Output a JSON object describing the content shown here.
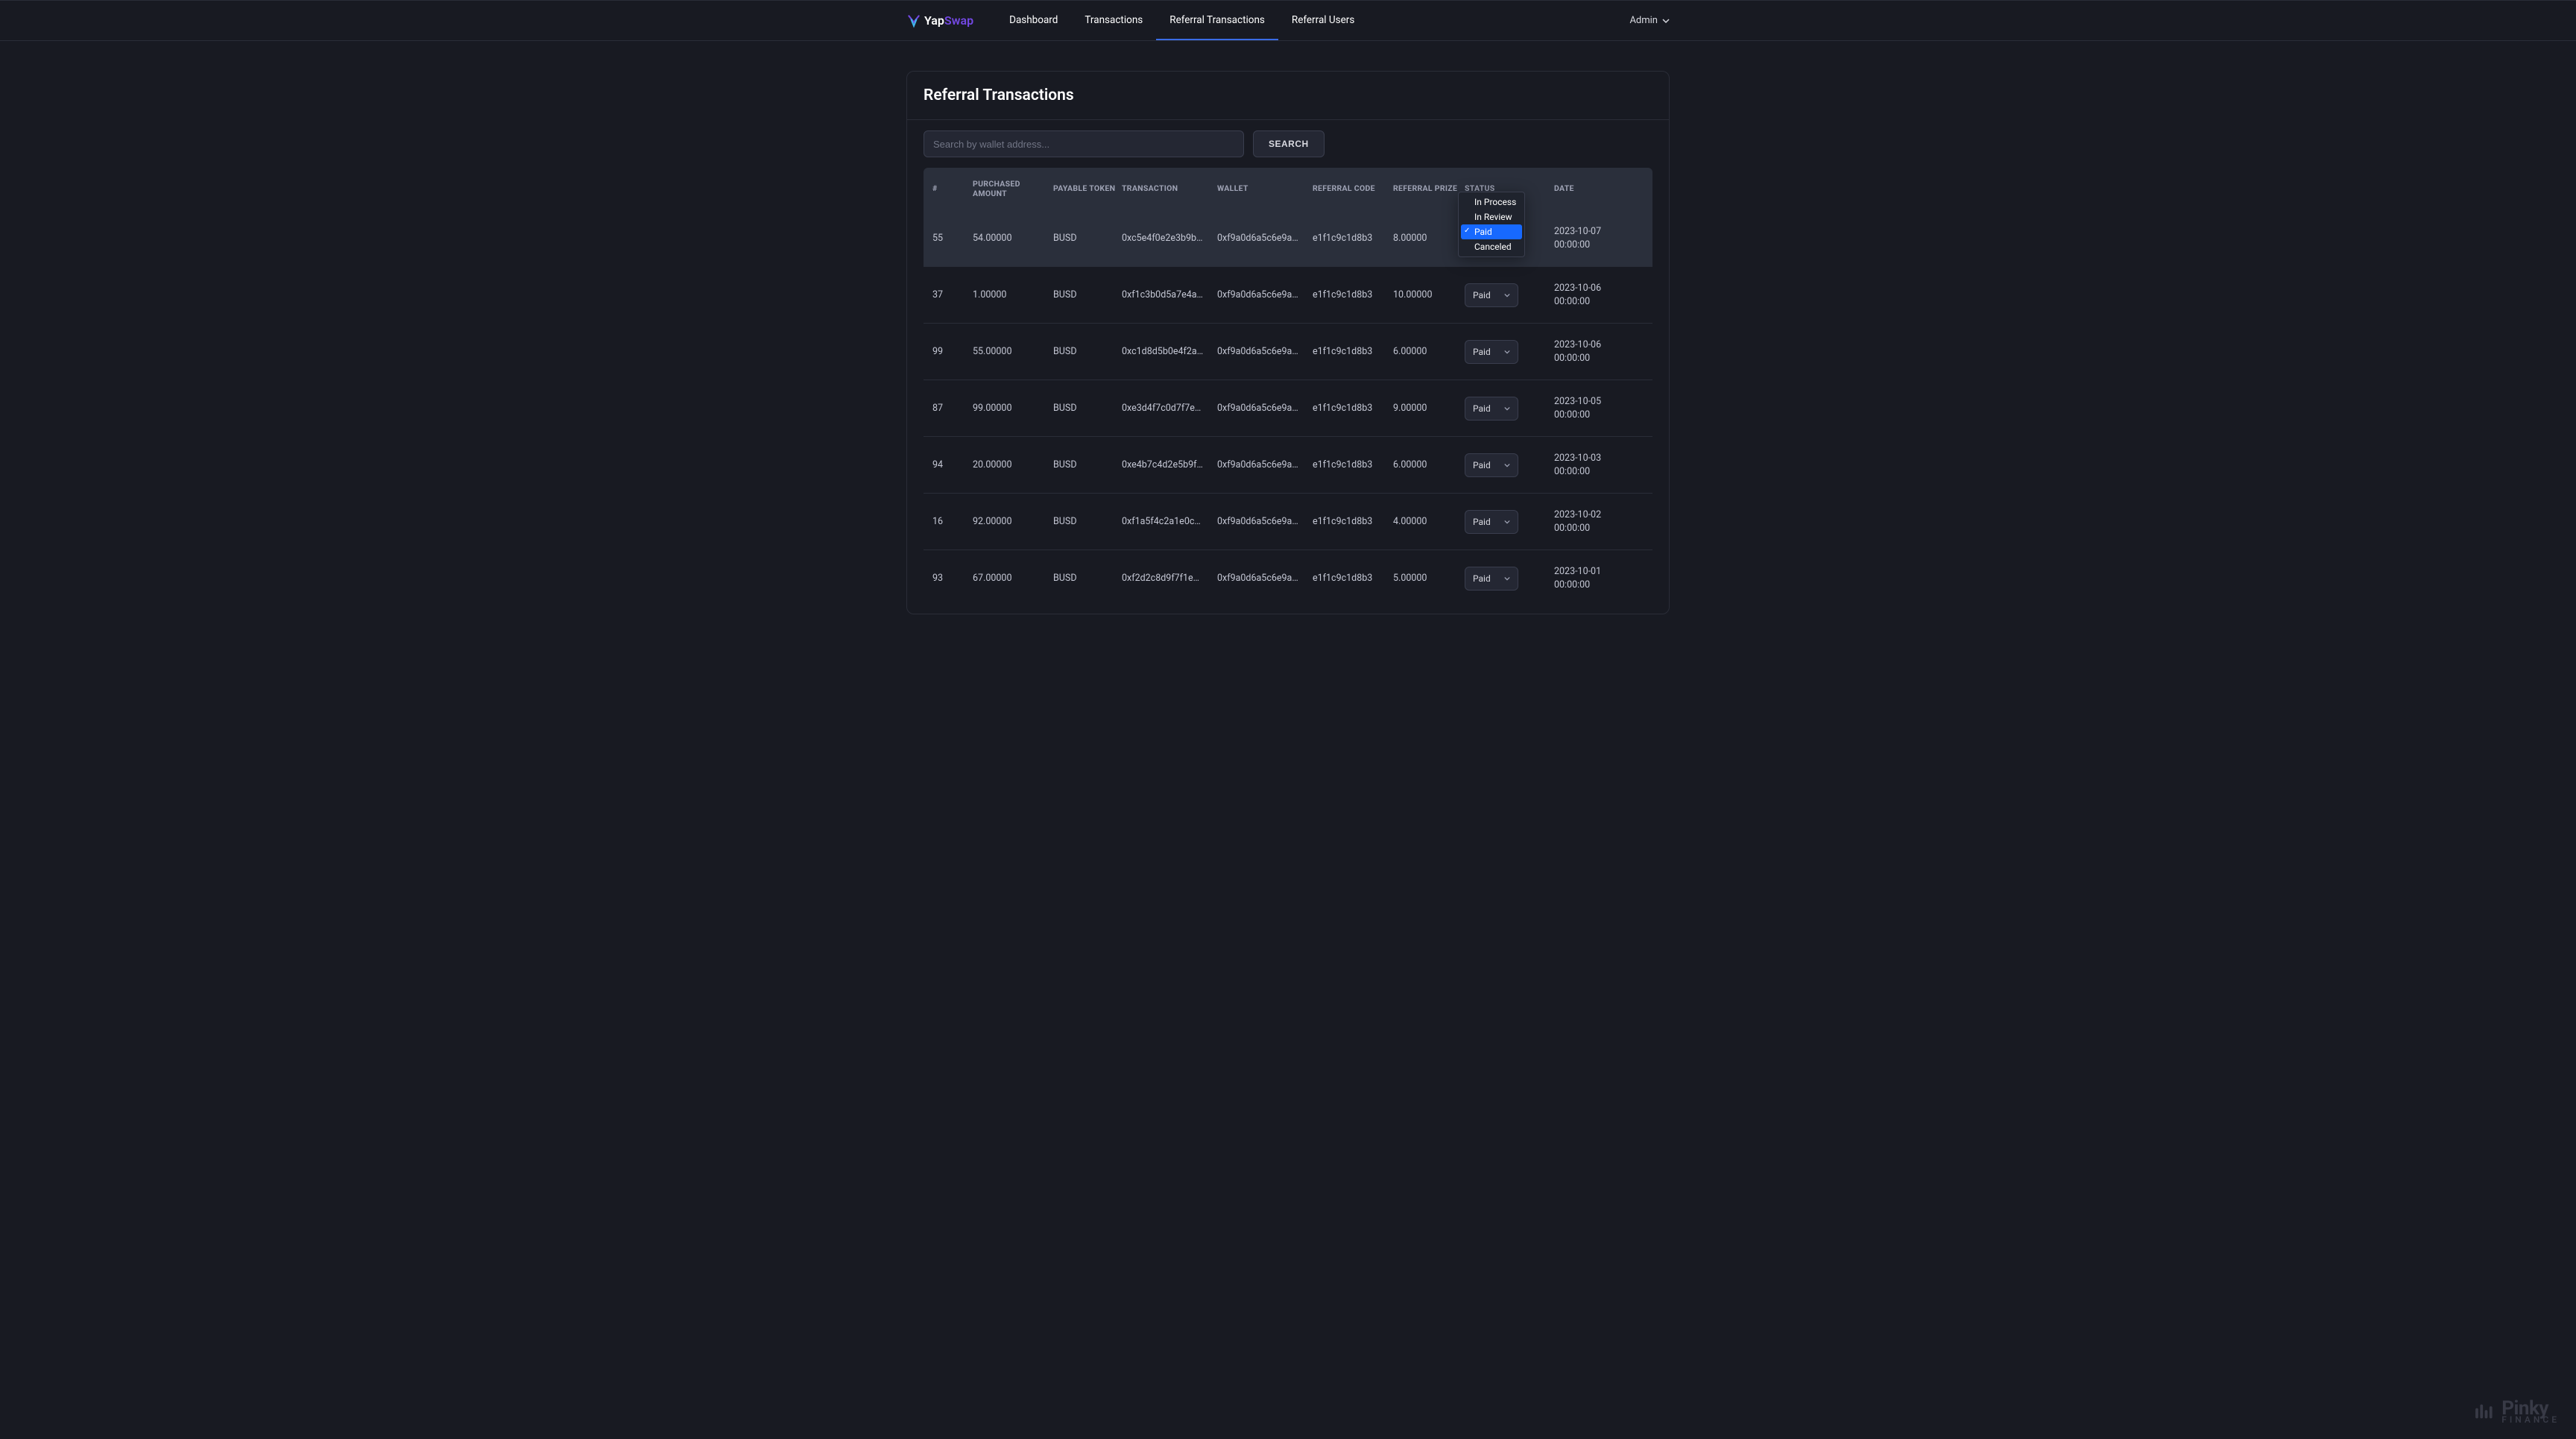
{
  "nav": {
    "brand_a": "Yap",
    "brand_b": "Swap",
    "links": [
      {
        "label": "Dashboard",
        "active": false
      },
      {
        "label": "Transactions",
        "active": false
      },
      {
        "label": "Referral Transactions",
        "active": true
      },
      {
        "label": "Referral Users",
        "active": false
      }
    ],
    "user_label": "Admin"
  },
  "page": {
    "title": "Referral Transactions",
    "search_placeholder": "Search by wallet address...",
    "search_button": "SEARCH"
  },
  "table": {
    "headers": [
      "#",
      "PURCHASED AMOUNT",
      "PAYABLE TOKEN",
      "TRANSACTION",
      "WALLET",
      "REFERRAL CODE",
      "REFERRAL PRIZE",
      "STATUS",
      "DATE"
    ],
    "rows": [
      {
        "id": "55",
        "purchased": "54.00000",
        "token": "BUSD",
        "tx": "0xc5e4f0e2e3b9b…",
        "wallet": "0xf9a0d6a5c6e9a…",
        "code": "e1f1c9c1d8b3",
        "prize": "8.00000",
        "status": "Paid",
        "date": "2023-10-07 00:00:00",
        "dropdown_open": true
      },
      {
        "id": "37",
        "purchased": "1.00000",
        "token": "BUSD",
        "tx": "0xf1c3b0d5a7e4a…",
        "wallet": "0xf9a0d6a5c6e9a…",
        "code": "e1f1c9c1d8b3",
        "prize": "10.00000",
        "status": "Paid",
        "date": "2023-10-06 00:00:00"
      },
      {
        "id": "99",
        "purchased": "55.00000",
        "token": "BUSD",
        "tx": "0xc1d8d5b0e4f2a…",
        "wallet": "0xf9a0d6a5c6e9a…",
        "code": "e1f1c9c1d8b3",
        "prize": "6.00000",
        "status": "Paid",
        "date": "2023-10-06 00:00:00"
      },
      {
        "id": "87",
        "purchased": "99.00000",
        "token": "BUSD",
        "tx": "0xe3d4f7c0d7f7e…",
        "wallet": "0xf9a0d6a5c6e9a…",
        "code": "e1f1c9c1d8b3",
        "prize": "9.00000",
        "status": "Paid",
        "date": "2023-10-05 00:00:00"
      },
      {
        "id": "94",
        "purchased": "20.00000",
        "token": "BUSD",
        "tx": "0xe4b7c4d2e5b9f…",
        "wallet": "0xf9a0d6a5c6e9a…",
        "code": "e1f1c9c1d8b3",
        "prize": "6.00000",
        "status": "Paid",
        "date": "2023-10-03 00:00:00"
      },
      {
        "id": "16",
        "purchased": "92.00000",
        "token": "BUSD",
        "tx": "0xf1a5f4c2a1e0c…",
        "wallet": "0xf9a0d6a5c6e9a…",
        "code": "e1f1c9c1d8b3",
        "prize": "4.00000",
        "status": "Paid",
        "date": "2023-10-02 00:00:00"
      },
      {
        "id": "93",
        "purchased": "67.00000",
        "token": "BUSD",
        "tx": "0xf2d2c8d9f7f1e…",
        "wallet": "0xf9a0d6a5c6e9a…",
        "code": "e1f1c9c1d8b3",
        "prize": "5.00000",
        "status": "Paid",
        "date": "2023-10-01 00:00:00"
      }
    ]
  },
  "status_options": [
    "In Process",
    "In Review",
    "Paid",
    "Canceled"
  ],
  "watermark": {
    "brand": "Pinky",
    "sub": "FINANCE"
  }
}
